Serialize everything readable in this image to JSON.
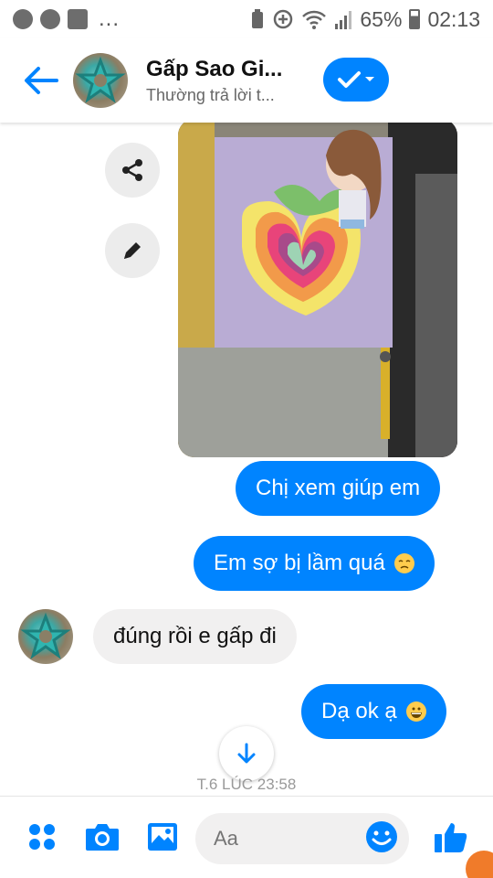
{
  "status_bar": {
    "dots": "...",
    "battery_percent": "65%",
    "time": "02:13"
  },
  "header": {
    "title": "Gấp Sao Gi...",
    "subtitle": "Thường trả lời t..."
  },
  "messages": [
    {
      "side": "out",
      "text": "Chị xem giúp em"
    },
    {
      "side": "out",
      "text": "Em sợ bị lầm quá",
      "emoji": "disappointed-face"
    },
    {
      "side": "in",
      "text": "đúng rồi e gấp đi"
    },
    {
      "side": "out",
      "text": "Dạ ok ạ",
      "emoji": "grinning-face"
    }
  ],
  "timestamp": "T.6 LÚC 23:58",
  "composer": {
    "placeholder": "Aa"
  },
  "colors": {
    "accent": "#0084ff",
    "incoming_bubble": "#f1f0f0"
  }
}
